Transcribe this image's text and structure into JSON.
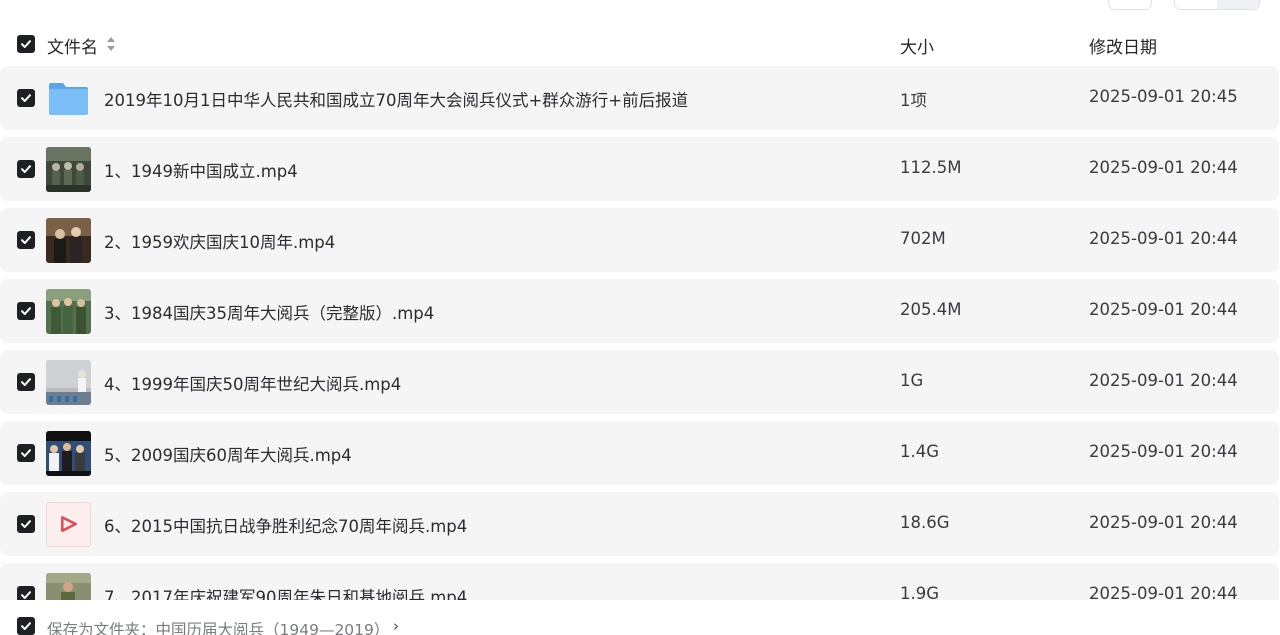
{
  "header": {
    "name_label": "文件名",
    "size_label": "大小",
    "date_label": "修改日期"
  },
  "files": [
    {
      "name": "2019年10月1日中华人民共和国成立70周年大会阅兵仪式+群众游行+前后报道",
      "size": "1项",
      "date": "2025-09-01 20:45",
      "icon": "folder-icon"
    },
    {
      "name": "1、1949新中国成立.mp4",
      "size": "112.5M",
      "date": "2025-09-01 20:44",
      "icon": "video-thumbnail"
    },
    {
      "name": "2、1959欢庆国庆10周年.mp4",
      "size": "702M",
      "date": "2025-09-01 20:44",
      "icon": "video-thumbnail"
    },
    {
      "name": "3、1984国庆35周年大阅兵（完整版）.mp4",
      "size": "205.4M",
      "date": "2025-09-01 20:44",
      "icon": "video-thumbnail"
    },
    {
      "name": "4、1999年国庆50周年世纪大阅兵.mp4",
      "size": "1G",
      "date": "2025-09-01 20:44",
      "icon": "video-thumbnail"
    },
    {
      "name": "5、2009国庆60周年大阅兵.mp4",
      "size": "1.4G",
      "date": "2025-09-01 20:44",
      "icon": "video-thumbnail"
    },
    {
      "name": "6、2015中国抗日战争胜利纪念70周年阅兵.mp4",
      "size": "18.6G",
      "date": "2025-09-01 20:44",
      "icon": "video-play-icon"
    },
    {
      "name": "7、2017年庆祝建军90周年朱日和基地阅兵.mp4",
      "size": "1.9G",
      "date": "2025-09-01 20:44",
      "icon": "video-thumbnail"
    }
  ],
  "footer": {
    "save_label": "保存为文件夹：中国历届大阅兵（1949—2019）",
    "chevron": "›"
  },
  "colors": {
    "row_bg": "#f5f5f6",
    "checkbox": "#1f2024",
    "folder": "#6db3f2",
    "play": "#e5484d"
  }
}
